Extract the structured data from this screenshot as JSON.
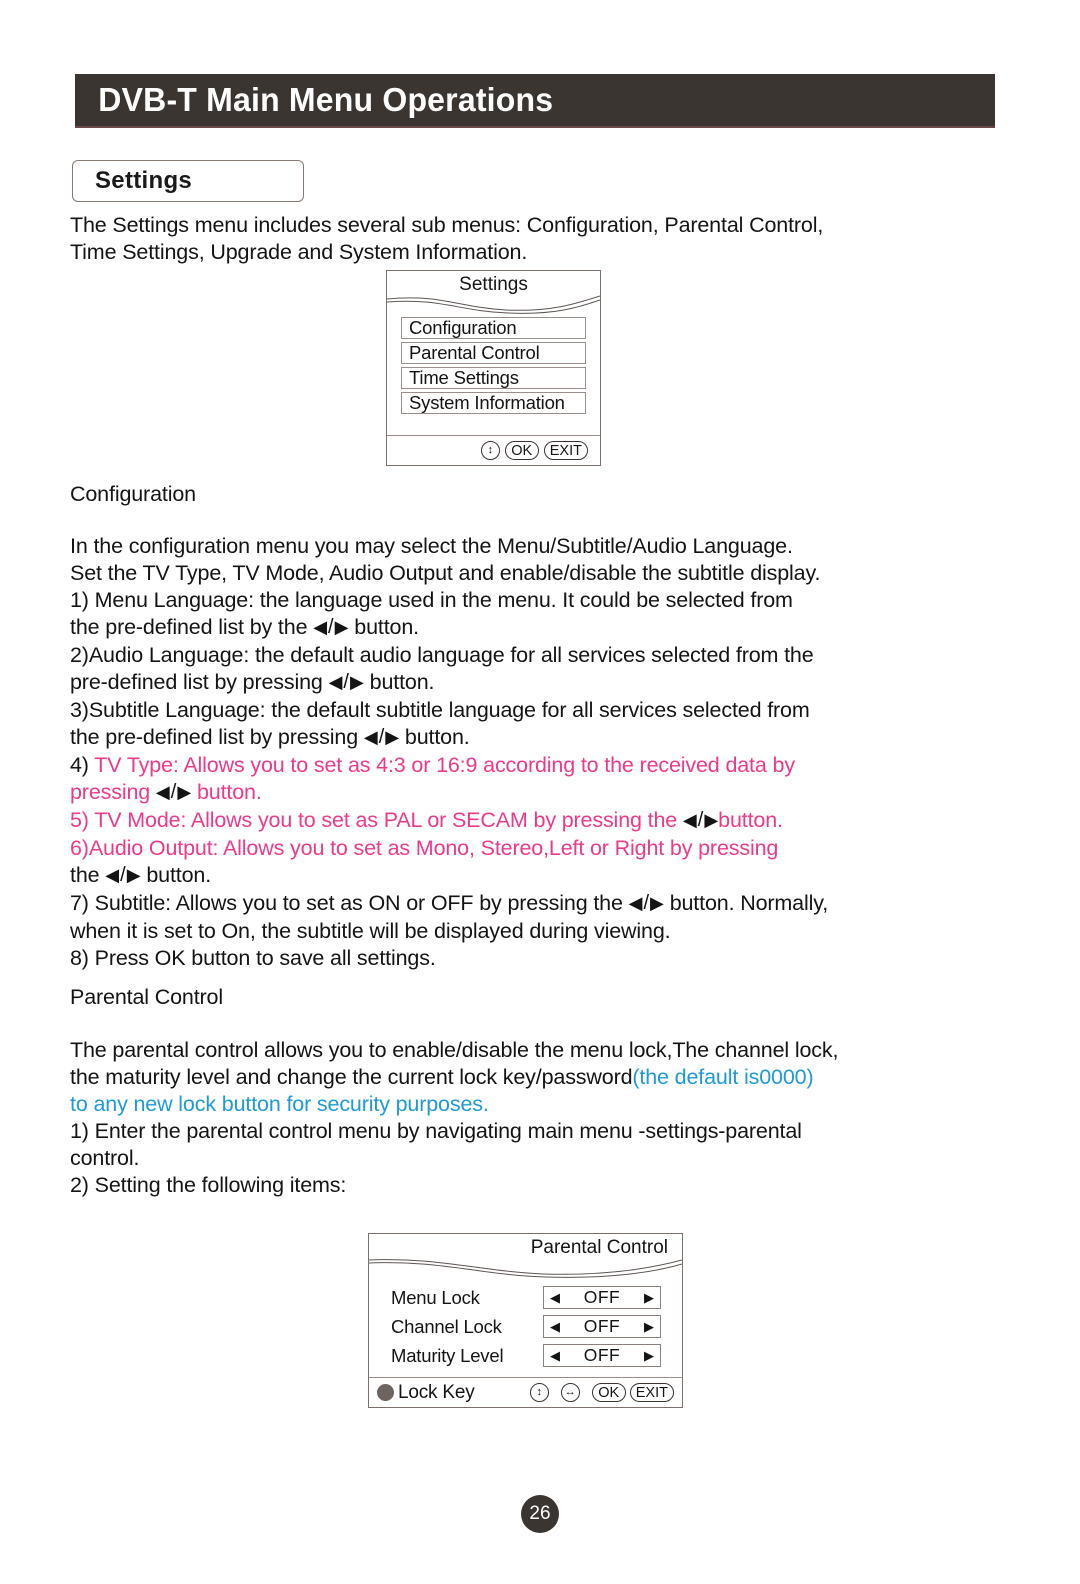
{
  "header": {
    "title": "DVB-T Main Menu Operations"
  },
  "section": {
    "label": "Settings"
  },
  "intro": {
    "line1": "The Settings menu includes several sub menus: Configuration, Parental Control,",
    "line2": "Time Settings, Upgrade and System Information."
  },
  "settings_osd": {
    "title": "Settings",
    "items": [
      {
        "label": "Configuration"
      },
      {
        "label": "Parental Control"
      },
      {
        "label": "Time Settings"
      },
      {
        "label": "System Information"
      }
    ],
    "footer": {
      "updown_icon": "updown-arrow-icon",
      "updown_glyph": "↕",
      "ok_label": "OK",
      "exit_label": "EXIT"
    }
  },
  "configuration": {
    "heading": "Configuration",
    "p1_line1": "In the configuration menu you may select the Menu/Subtitle/Audio Language.",
    "p1_line2": "Set the TV Type, TV Mode, Audio Output and enable/disable the subtitle display.",
    "item1_a": "1) Menu Language: the language used in the menu. It could be selected from",
    "item1_b_pre": "the pre-defined list by the",
    "item1_b_post": "button.",
    "item2_a": "2)Audio Language: the default audio language for all services selected from the",
    "item2_b_pre": "pre-defined list by pressing",
    "item2_b_post": "button.",
    "item3_a": "3)Subtitle Language: the default subtitle language for all services selected from",
    "item3_b_pre": "the pre-defined list by pressing",
    "item3_b_post": "button.",
    "item4_num": "4)",
    "item4_a": " TV Type: Allows you to set as 4:3 or 16:9 according to the received data by",
    "item4_b_pre": "pressing",
    "item4_b_post": "button.",
    "item5_pre": "5) TV Mode: Allows you to set as PAL or SECAM by pressing the",
    "item5_post": "button.",
    "item6_a": "6)Audio Output: Allows you to set as Mono, Stereo,Left or Right by pressing",
    "item6_b_pre": "the",
    "item6_b_post": "button.",
    "item7_a_pre": "7) Subtitle: Allows you to set as ON or OFF by pressing the",
    "item7_a_post": "button. Normally,",
    "item7_b": "when it is set to On, the subtitle will be displayed during viewing.",
    "item8": "8) Press OK button to save all settings."
  },
  "parental": {
    "heading": "Parental Control",
    "p1_a": "The parental control allows you to enable/disable the menu lock,The channel lock,",
    "p1_b": "the maturity level and change the current lock key/password",
    "p1_b_blue": "(the default is0000)",
    "p1_c_blue": "to any new lock button for security purposes.",
    "item1_a": "1) Enter the parental control menu by navigating main menu -settings-parental",
    "item1_b": "control.",
    "item2": "2) Setting the following items:"
  },
  "parental_osd": {
    "title": "Parental Control",
    "rows": [
      {
        "label": "Menu Lock",
        "value": "OFF"
      },
      {
        "label": "Channel Lock",
        "value": "OFF"
      },
      {
        "label": "Maturity Level",
        "value": "OFF"
      }
    ],
    "left_tri": "◀",
    "right_tri": "▶",
    "footer": {
      "lock_key_label": "Lock Key",
      "updown_glyph": "↕",
      "leftright_glyph": "↔",
      "ok_label": "OK",
      "exit_label": "EXIT"
    }
  },
  "footer": {
    "page_number": "26"
  },
  "colors": {
    "header_bg": "#3a3531",
    "magenta": "#ec3a8b",
    "cyan": "#1f9ad6",
    "text": "#141414"
  },
  "arrow_glyphs": {
    "left": "◀",
    "right": "▶",
    "slash": "/"
  }
}
